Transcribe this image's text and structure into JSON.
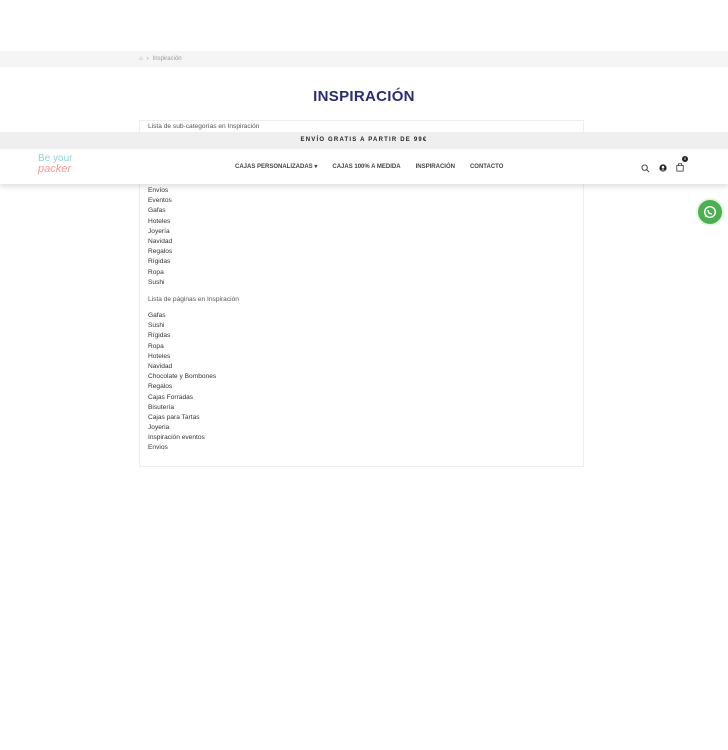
{
  "breadcrumb": {
    "current": "Inspiración"
  },
  "page_title": "INSPIRACIÓN",
  "subcategories": {
    "heading": "Lista de sub-categorías en Inspiración",
    "items": [
      "Envíos",
      "Eventos",
      "Gafas",
      "Hoteles",
      "Joyería",
      "Navidad",
      "Regalos",
      "Rígidas",
      "Ropa",
      "Sushi"
    ]
  },
  "pages": {
    "heading": "Lista de páginas en Inspiración",
    "items": [
      "Gafas",
      "Sushi",
      "Rígidas",
      "Ropa",
      "Hoteles",
      "Navidad",
      "Chocolate y Bombones",
      "Regalos",
      "Cajas Forradas",
      "Bisutería",
      "Cajas para Tartas",
      "Joyeria",
      "Inspiración eventos",
      "Envios"
    ]
  },
  "topbar": "ENVÍO GRATIS A PARTIR DE 99€",
  "logo": {
    "line1": "Be your",
    "line2": "packer"
  },
  "menu": [
    "CAJAS PERSONALIZADAS ▾",
    "CAJAS 100% A MEDIDA",
    "INSPIRACIÓN",
    "CONTACTO"
  ],
  "cart_count": "0"
}
